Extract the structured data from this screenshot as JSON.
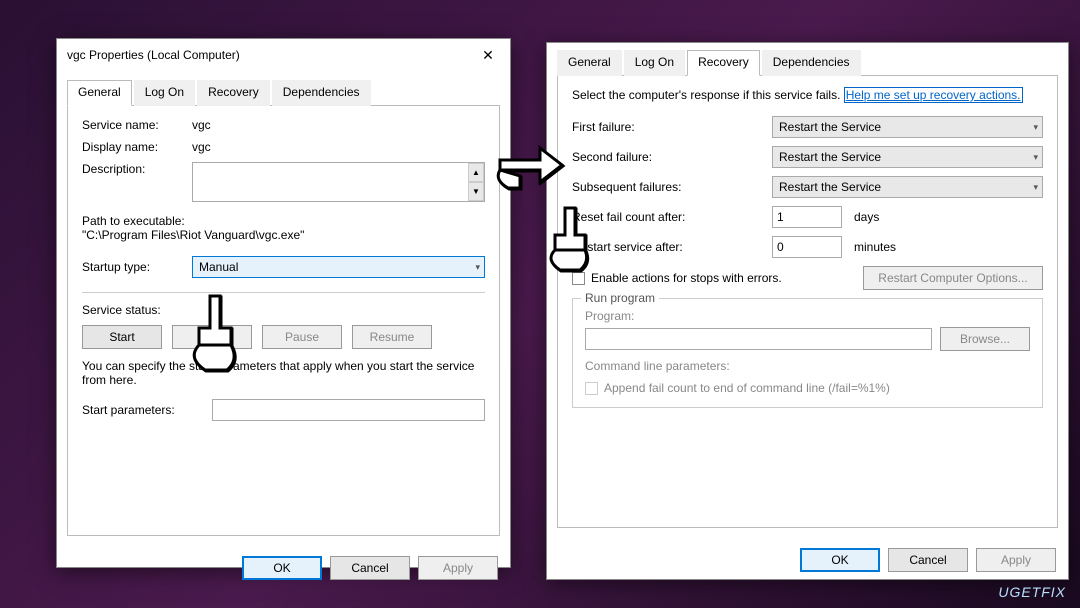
{
  "left": {
    "title": "vgc Properties (Local Computer)",
    "tabs": [
      "General",
      "Log On",
      "Recovery",
      "Dependencies"
    ],
    "active_tab": 0,
    "service_name_label": "Service name:",
    "service_name_value": "vgc",
    "display_name_label": "Display name:",
    "display_name_value": "vgc",
    "description_label": "Description:",
    "path_label": "Path to executable:",
    "path_value": "\"C:\\Program Files\\Riot Vanguard\\vgc.exe\"",
    "startup_type_label": "Startup type:",
    "startup_type_value": "Manual",
    "service_status_label": "Service status:",
    "buttons": {
      "start": "Start",
      "stop": "Stop",
      "pause": "Pause",
      "resume": "Resume"
    },
    "hint": "You can specify the start parameters that apply when you start the service from here.",
    "start_params_label": "Start parameters:",
    "footer": {
      "ok": "OK",
      "cancel": "Cancel",
      "apply": "Apply"
    }
  },
  "right": {
    "tabs": [
      "General",
      "Log On",
      "Recovery",
      "Dependencies"
    ],
    "active_tab": 2,
    "intro": "Select the computer's response if this service fails.",
    "help_link": "Help me set up recovery actions.",
    "first_failure_label": "First failure:",
    "first_failure_value": "Restart the Service",
    "second_failure_label": "Second failure:",
    "second_failure_value": "Restart the Service",
    "subseq_failure_label": "Subsequent failures:",
    "subseq_failure_value": "Restart the Service",
    "reset_label": "Reset fail count after:",
    "reset_value": "1",
    "reset_unit": "days",
    "restart_label": "Restart service after:",
    "restart_value": "0",
    "restart_unit": "minutes",
    "enable_actions_label": "Enable actions for stops with errors.",
    "restart_computer_btn": "Restart Computer Options...",
    "run_program_label": "Run program",
    "program_label": "Program:",
    "browse_btn": "Browse...",
    "cmdline_label": "Command line parameters:",
    "append_label": "Append fail count to end of command line (/fail=%1%)",
    "footer": {
      "ok": "OK",
      "cancel": "Cancel",
      "apply": "Apply"
    }
  },
  "watermark": "UGETFIX"
}
